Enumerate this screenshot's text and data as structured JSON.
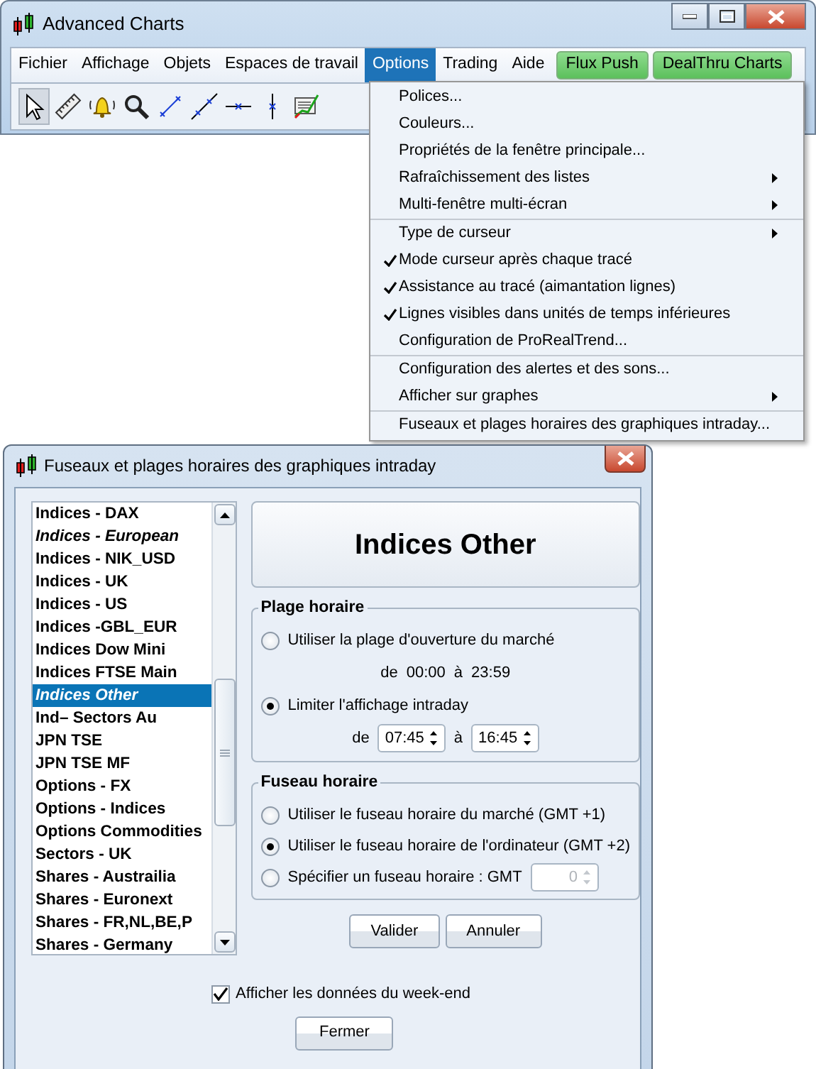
{
  "app_window": {
    "title": "Advanced Charts"
  },
  "menu_bar": {
    "items": [
      {
        "label": "Fichier",
        "selected": false
      },
      {
        "label": "Affichage",
        "selected": false
      },
      {
        "label": "Objets",
        "selected": false
      },
      {
        "label": "Espaces de travail",
        "selected": false
      },
      {
        "label": "Options",
        "selected": true
      },
      {
        "label": "Trading",
        "selected": false
      },
      {
        "label": "Aide",
        "selected": false
      }
    ],
    "buttons": [
      "Flux Push",
      "DealThru Charts"
    ]
  },
  "toolbar": {
    "tools": [
      {
        "kind": "pointer",
        "selected": true
      },
      {
        "kind": "ruler",
        "selected": false
      },
      {
        "kind": "bell",
        "selected": false
      },
      {
        "kind": "magnifier",
        "selected": false
      },
      {
        "kind": "segment",
        "selected": false
      },
      {
        "kind": "line",
        "selected": false
      },
      {
        "kind": "hline",
        "selected": false
      },
      {
        "kind": "vline",
        "selected": false
      },
      {
        "kind": "trend",
        "selected": false
      }
    ]
  },
  "options_menu": {
    "groups": [
      {
        "items": [
          {
            "label": "Polices...",
            "checked": false,
            "submenu": false
          },
          {
            "label": "Couleurs...",
            "checked": false,
            "submenu": false
          },
          {
            "label": "Propriétés de la fenêtre principale...",
            "checked": false,
            "submenu": false
          },
          {
            "label": "Rafraîchissement des listes",
            "checked": false,
            "submenu": true
          },
          {
            "label": "Multi-fenêtre multi-écran",
            "checked": false,
            "submenu": true
          }
        ]
      },
      {
        "items": [
          {
            "label": "Type de curseur",
            "checked": false,
            "submenu": true
          },
          {
            "label": "Mode curseur après chaque tracé",
            "checked": true,
            "submenu": false
          },
          {
            "label": "Assistance au tracé (aimantation lignes)",
            "checked": true,
            "submenu": false
          },
          {
            "label": "Lignes visibles dans unités de temps inférieures",
            "checked": true,
            "submenu": false
          },
          {
            "label": "Configuration de ProRealTrend...",
            "checked": false,
            "submenu": false
          }
        ]
      },
      {
        "items": [
          {
            "label": "Configuration des alertes et des sons...",
            "checked": false,
            "submenu": false
          },
          {
            "label": "Afficher sur graphes",
            "checked": false,
            "submenu": true
          }
        ]
      },
      {
        "items": [
          {
            "label": "Fuseaux et plages horaires des graphiques intraday...",
            "checked": false,
            "submenu": false
          }
        ]
      }
    ]
  },
  "dialog": {
    "title": "Fuseaux et plages horaires des graphiques intraday",
    "list": {
      "items": [
        {
          "label": "Indices - DAX",
          "italic": false,
          "selected": false
        },
        {
          "label": "Indices - European",
          "italic": true,
          "selected": false
        },
        {
          "label": "Indices - NIK_USD",
          "italic": false,
          "selected": false
        },
        {
          "label": "Indices - UK",
          "italic": false,
          "selected": false
        },
        {
          "label": "Indices - US",
          "italic": false,
          "selected": false
        },
        {
          "label": "Indices -GBL_EUR",
          "italic": false,
          "selected": false
        },
        {
          "label": "Indices Dow Mini",
          "italic": false,
          "selected": false
        },
        {
          "label": "Indices FTSE Main",
          "italic": false,
          "selected": false
        },
        {
          "label": "Indices Other",
          "italic": true,
          "selected": true
        },
        {
          "label": "Ind– Sectors Au",
          "italic": false,
          "selected": false
        },
        {
          "label": "JPN TSE",
          "italic": false,
          "selected": false
        },
        {
          "label": "JPN TSE MF",
          "italic": false,
          "selected": false
        },
        {
          "label": "Options - FX",
          "italic": false,
          "selected": false
        },
        {
          "label": "Options - Indices",
          "italic": false,
          "selected": false
        },
        {
          "label": "Options Commodities",
          "italic": false,
          "selected": false
        },
        {
          "label": "Sectors - UK",
          "italic": false,
          "selected": false
        },
        {
          "label": "Shares - Austrailia",
          "italic": false,
          "selected": false
        },
        {
          "label": "Shares - Euronext",
          "italic": false,
          "selected": false
        },
        {
          "label": "Shares - FR,NL,BE,P",
          "italic": false,
          "selected": false
        },
        {
          "label": "Shares - Germany",
          "italic": false,
          "selected": false
        }
      ]
    },
    "header": "Indices Other",
    "time_range": {
      "legend": "Plage horaire",
      "options": [
        {
          "kind": "fixed",
          "label": "Utiliser la plage d'ouverture du marché",
          "selected": false,
          "from_label": "de",
          "from": "00:00",
          "to_label": "à",
          "to": "23:59"
        },
        {
          "kind": "spinners",
          "label": "Limiter l'affichage intraday",
          "selected": true,
          "from_label": "de",
          "from": "07:45",
          "to_label": "à",
          "to": "16:45"
        }
      ]
    },
    "time_zone": {
      "legend": "Fuseau horaire",
      "options": [
        {
          "kind": "plain",
          "label": "Utiliser le fuseau horaire du marché (GMT +1)",
          "selected": false
        },
        {
          "kind": "plain",
          "label": "Utiliser le fuseau horaire de l'ordinateur (GMT +2)",
          "selected": true
        },
        {
          "kind": "gmt",
          "label": "Spécifier un fuseau horaire : GMT",
          "selected": false,
          "value": "0",
          "disabled": true
        }
      ]
    },
    "buttons": [
      "Valider",
      "Annuler"
    ],
    "weekend": {
      "label": "Afficher les données du week-end",
      "checked": true
    },
    "close_button": "Fermer"
  }
}
